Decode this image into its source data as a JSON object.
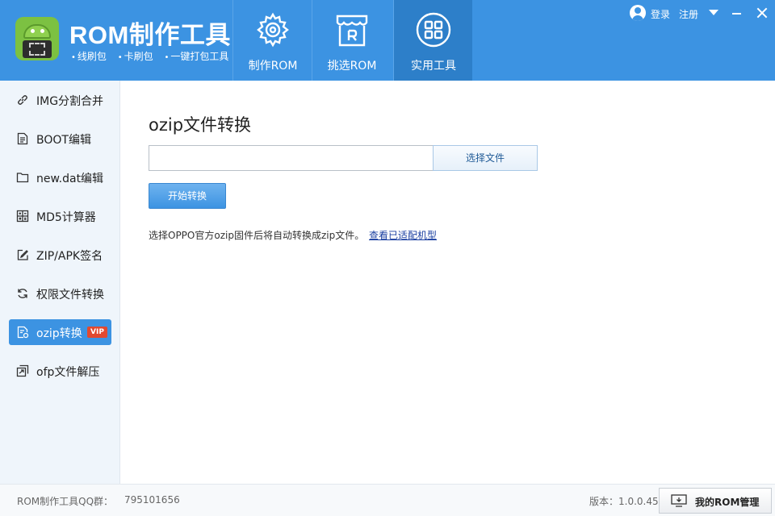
{
  "app": {
    "title": "ROM制作工具",
    "subtitle_items": [
      "线刷包",
      "卡刷包",
      "一键打包工具"
    ]
  },
  "nav": {
    "tabs": [
      {
        "label": "制作ROM",
        "icon": "gear-icon"
      },
      {
        "label": "挑选ROM",
        "icon": "store-icon"
      },
      {
        "label": "实用工具",
        "icon": "grid-icon",
        "active": true
      }
    ]
  },
  "top_right": {
    "login": "登录",
    "register": "注册"
  },
  "sidebar": {
    "items": [
      {
        "label": "IMG分割合并",
        "icon": "link-icon"
      },
      {
        "label": "BOOT编辑",
        "icon": "document-icon"
      },
      {
        "label": "new.dat编辑",
        "icon": "folder-icon"
      },
      {
        "label": "MD5计算器",
        "icon": "calculator-icon"
      },
      {
        "label": "ZIP/APK签名",
        "icon": "edit-icon"
      },
      {
        "label": "权限文件转换",
        "icon": "refresh-icon"
      },
      {
        "label": "ozip转换",
        "icon": "file-settings-icon",
        "active": true,
        "badge": "VIP"
      },
      {
        "label": "ofp文件解压",
        "icon": "file-extract-icon"
      }
    ]
  },
  "main": {
    "title": "ozip文件转换",
    "file_input_value": "",
    "choose_button": "选择文件",
    "start_button": "开始转换",
    "description": "选择OPPO官方ozip固件后将自动转换成zip文件。",
    "link": "查看已适配机型"
  },
  "footer": {
    "qq_label": "ROM制作工具QQ群：",
    "qq_number": "795101656",
    "version": "版本：1.0.0.45",
    "rom_manage_button": "我的ROM管理"
  },
  "colors": {
    "accent": "#3c93e2",
    "active_tab": "#2d7fc9",
    "vip": "#e2492f",
    "link": "#1a3fa0"
  }
}
